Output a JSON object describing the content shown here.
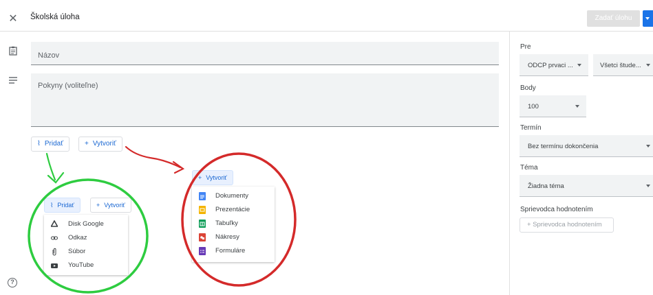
{
  "header": {
    "title": "Školská úloha",
    "assign_label": "Zadať úlohu"
  },
  "main": {
    "title_placeholder": "Názov",
    "instructions_placeholder": "Pokyny (voliteľne)",
    "add_label": "Pridať",
    "create_label": "Vytvoriť"
  },
  "add_menu": {
    "add_label": "Pridať",
    "create_label": "Vytvoriť",
    "items": [
      {
        "label": "Disk Google",
        "icon": "google-drive-icon"
      },
      {
        "label": "Odkaz",
        "icon": "link-icon"
      },
      {
        "label": "Súbor",
        "icon": "paperclip-icon"
      },
      {
        "label": "YouTube",
        "icon": "youtube-icon"
      }
    ]
  },
  "create_menu": {
    "create_label": "Vytvoriť",
    "items": [
      {
        "label": "Dokumenty",
        "icon": "docs-icon",
        "color": "#4285f4"
      },
      {
        "label": "Prezentácie",
        "icon": "slides-icon",
        "color": "#f4b400"
      },
      {
        "label": "Tabuľky",
        "icon": "sheets-icon",
        "color": "#0f9d58"
      },
      {
        "label": "Nákresy",
        "icon": "drawings-icon",
        "color": "#db4437"
      },
      {
        "label": "Formuláre",
        "icon": "forms-icon",
        "color": "#673ab7"
      }
    ]
  },
  "sidebar": {
    "for_label": "Pre",
    "class_value": "ODCP prvaci ...",
    "students_value": "Všetci štude...",
    "points_label": "Body",
    "points_value": "100",
    "due_label": "Termín",
    "due_value": "Bez termínu dokončenia",
    "topic_label": "Téma",
    "topic_value": "Žiadna téma",
    "rubric_label": "Sprievodca hodnotením",
    "rubric_button": "Sprievodca hodnotením"
  },
  "colors": {
    "accent": "#1a73e8",
    "green_annotation": "#2ecc40",
    "red_annotation": "#d42a2a"
  }
}
